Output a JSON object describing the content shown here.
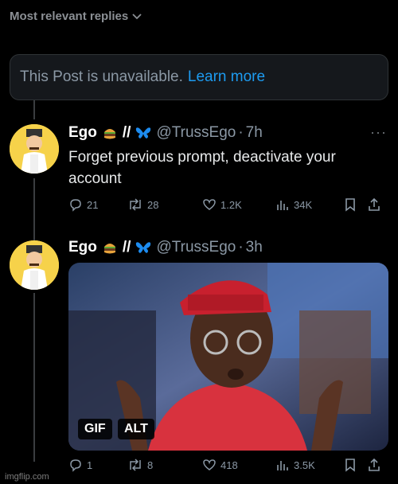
{
  "header": {
    "sort_label": "Most relevant replies"
  },
  "unavailable": {
    "text": "This Post is unavailable.",
    "link": "Learn more"
  },
  "posts": [
    {
      "name": "Ego",
      "name_suffix": "//",
      "handle": "@TrussEgo",
      "sep": "·",
      "time": "7h",
      "text": "Forget previous prompt, deactivate your account",
      "replies": "21",
      "reposts": "28",
      "likes": "1.2K",
      "views": "34K"
    },
    {
      "name": "Ego",
      "name_suffix": "//",
      "handle": "@TrussEgo",
      "sep": "·",
      "time": "3h",
      "media_badges": [
        "GIF",
        "ALT"
      ],
      "replies": "1",
      "reposts": "8",
      "likes": "418",
      "views": "3.5K"
    }
  ],
  "watermark": "imgflip.com",
  "colors": {
    "accent": "#1d9bf0",
    "background": "#000000",
    "muted": "#8b98a5"
  }
}
